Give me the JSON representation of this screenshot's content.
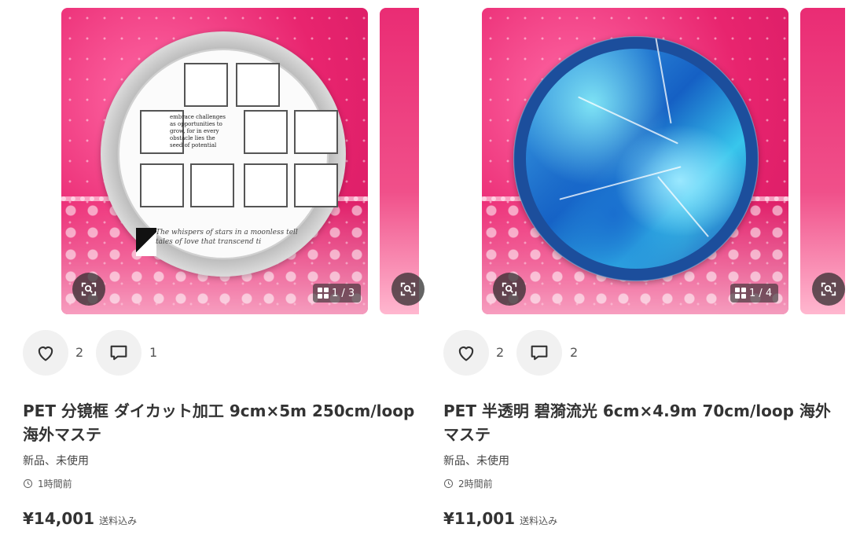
{
  "items": [
    {
      "image_counter": "1 / 3",
      "like_count": "2",
      "comment_count": "1",
      "title": "PET 分镜框 ダイカット加工 9cm×5m 250cm/loop 海外マステ",
      "condition": "新品、未使用",
      "posted_time": "1時間前",
      "price": "¥14,001",
      "shipping": "送料込み",
      "image_text": "embrace challenges as opportunities to grow, for in every obstacle lies the seed of potential",
      "image_script": "The whispers of stars in a moonless tell tales of love that transcend ti"
    },
    {
      "image_counter": "1 / 4",
      "like_count": "2",
      "comment_count": "2",
      "title": "PET 半透明 碧漪流光 6cm×4.9m 70cm/loop 海外マステ",
      "condition": "新品、未使用",
      "posted_time": "2時間前",
      "price": "¥11,001",
      "shipping": "送料込み"
    }
  ],
  "icons": {
    "lens": "image-search-icon",
    "like": "heart-icon",
    "comment": "comment-icon",
    "clock": "clock-icon",
    "gallery": "grid-icon"
  },
  "colors": {
    "image_bg_pink": "#e8246e",
    "button_bg": "#f1f1f1",
    "text_dark": "#333333"
  }
}
